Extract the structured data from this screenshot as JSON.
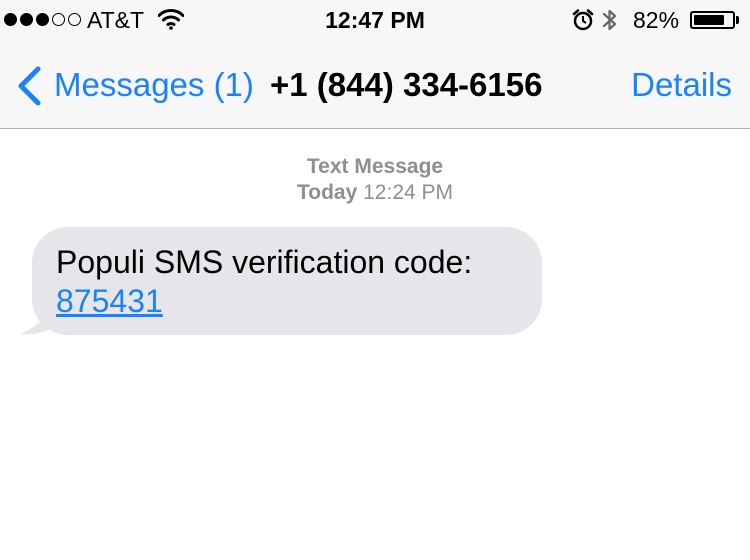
{
  "status_bar": {
    "carrier": "AT&T",
    "signal_bars_filled": 3,
    "signal_bars_total": 5,
    "time": "12:47 PM",
    "battery_percent": "82%",
    "battery_level": 0.82,
    "icons": [
      "signal-dots-icon",
      "wifi-icon",
      "alarm-icon",
      "bluetooth-icon",
      "battery-icon"
    ]
  },
  "nav": {
    "back_label": "Messages (1)",
    "title": "+1 (844) 334-6156",
    "details_label": "Details"
  },
  "conversation": {
    "service_label": "Text Message",
    "day_label": "Today",
    "time_label": "12:24 PM",
    "messages": [
      {
        "direction": "incoming",
        "text": "Populi SMS verification code:",
        "code": "875431"
      }
    ]
  },
  "colors": {
    "accent": "#1a82fb",
    "bar_background": "#f7f7f8",
    "bubble_incoming": "#e5e5ea",
    "meta_text": "#8e8e93"
  }
}
